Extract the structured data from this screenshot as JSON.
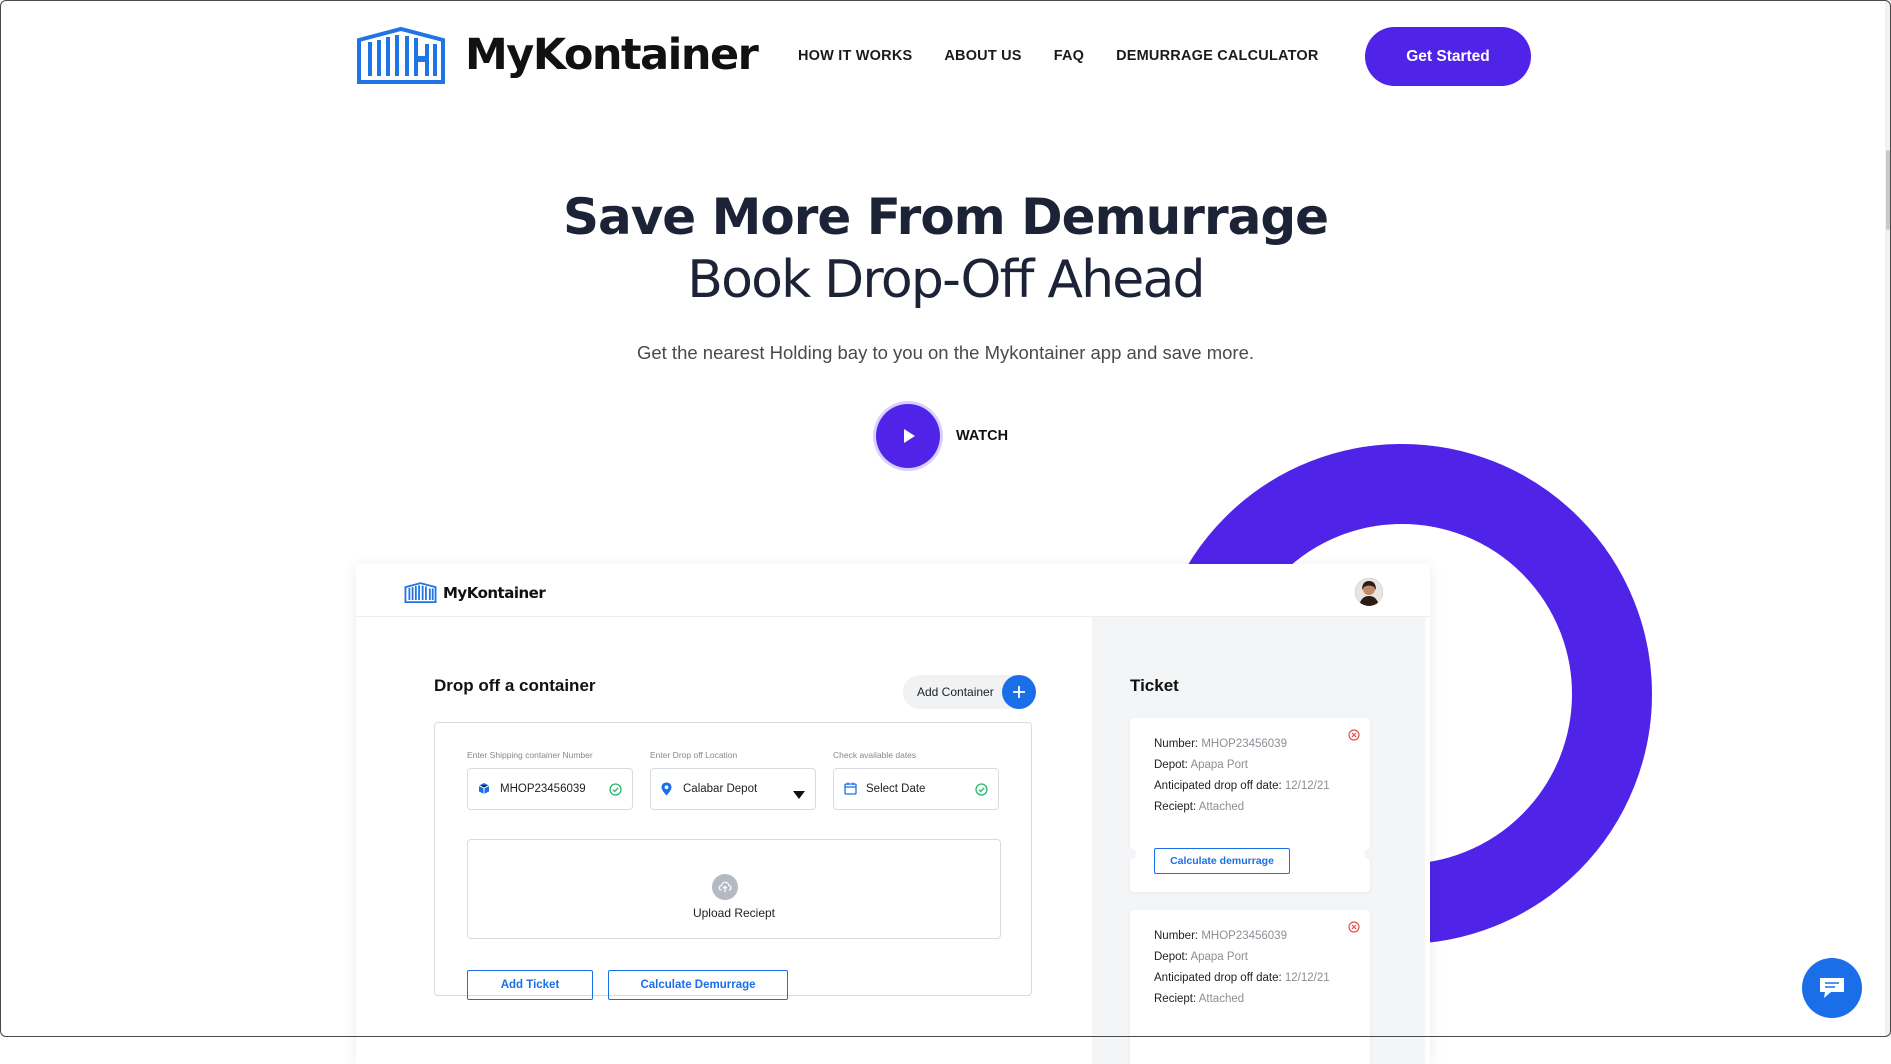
{
  "header": {
    "brand": "MyKontainer",
    "nav": [
      "HOW IT WORKS",
      "ABOUT US",
      "FAQ",
      "DEMURRAGE CALCULATOR"
    ],
    "cta": "Get Started"
  },
  "hero": {
    "title": "Save More From Demurrage",
    "subtitle": "Book Drop-Off Ahead",
    "description": "Get the nearest Holding bay to you on the Mykontainer app and save more.",
    "watch_label": "WATCH"
  },
  "app": {
    "brand": "MyKontainer",
    "drop_title": "Drop off a container",
    "add_container": "Add Container",
    "fields": [
      {
        "label": "Enter Shipping container Number",
        "value": "MHOP23456039"
      },
      {
        "label": "Enter Drop off Location",
        "value": "Calabar Depot"
      },
      {
        "label": "Check available dates",
        "value": "Select Date"
      }
    ],
    "upload_label": "Upload Reciept",
    "add_ticket": "Add Ticket",
    "calculate": "Calculate Demurrage",
    "ticket_title": "Ticket",
    "tickets": [
      {
        "number_label": "Number:",
        "number": "MHOP23456039",
        "depot_label": "Depot:",
        "depot": "Apapa Port",
        "date_label": "Anticipated drop off date:",
        "date": "12/12/21",
        "receipt_label": "Reciept:",
        "receipt": "Attached",
        "button": "Calculate demurrage"
      },
      {
        "number_label": "Number:",
        "number": "MHOP23456039",
        "depot_label": "Depot:",
        "depot": "Apapa Port",
        "date_label": "Anticipated drop off date:",
        "date": "12/12/21",
        "receipt_label": "Reciept:",
        "receipt": "Attached"
      }
    ]
  },
  "colors": {
    "brand_purple": "#4f24e8",
    "accent_blue": "#1a6fe8",
    "logo_blue": "#1f74e6"
  }
}
